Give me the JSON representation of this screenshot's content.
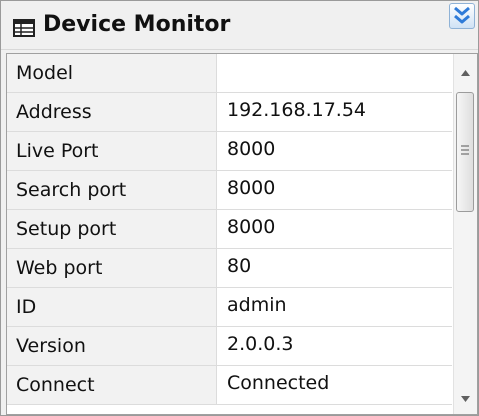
{
  "window": {
    "title": "Device Monitor",
    "title_icon": "table-icon",
    "collapse_icon": "double-chevron-down-icon"
  },
  "properties": [
    {
      "name": "Model",
      "value": ""
    },
    {
      "name": "Address",
      "value": "192.168.17.54"
    },
    {
      "name": "Live Port",
      "value": "8000"
    },
    {
      "name": "Search port",
      "value": "8000"
    },
    {
      "name": "Setup port",
      "value": "8000"
    },
    {
      "name": "Web port",
      "value": "80"
    },
    {
      "name": "ID",
      "value": "admin"
    },
    {
      "name": "Version",
      "value": "2.0.0.3"
    },
    {
      "name": "Connect",
      "value": "Connected"
    }
  ],
  "scrollbar": {
    "up_icon": "arrow-up-icon",
    "down_icon": "arrow-down-icon",
    "grip_icon": "grip-lines-icon"
  },
  "colors": {
    "accent": "#2f7bd8",
    "name_column_bg": "#f2f2f2"
  }
}
